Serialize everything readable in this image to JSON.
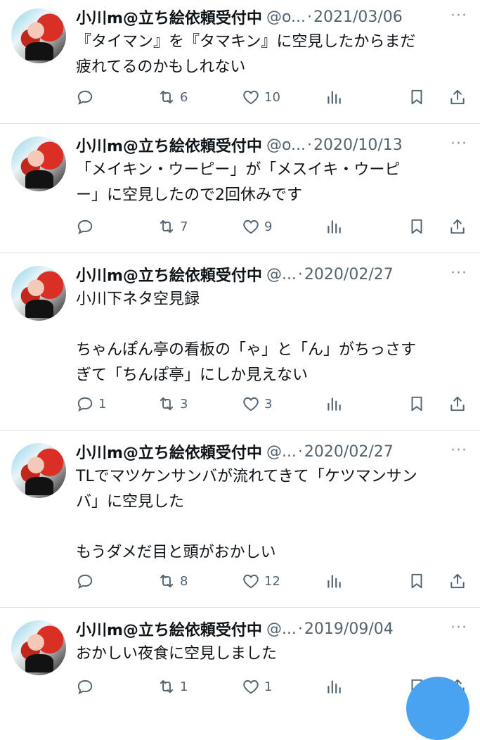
{
  "tweets": [
    {
      "name": "小川m@立ち絵依頼受付中",
      "handle": "@o...",
      "date": "2021/03/06",
      "text": "『タイマン』を『タマキン』に空見したからまだ\n疲れてるのかもしれない",
      "replies": "",
      "retweets": "6",
      "likes": "10"
    },
    {
      "name": "小川m@立ち絵依頼受付中",
      "handle": "@o...",
      "date": "2020/10/13",
      "text": "「メイキン・ウーピー」が「メスイキ・ウーピ\nー」に空見したので2回休みです",
      "replies": "",
      "retweets": "7",
      "likes": "9"
    },
    {
      "name": "小川m@立ち絵依頼受付中",
      "handle": "@...",
      "date": "2020/02/27",
      "text": "小川下ネタ空見録\n\nちゃんぽん亭の看板の「ゃ」と「ん」がちっさす\nぎて「ちんぽ亭」にしか見えない",
      "replies": "1",
      "retweets": "3",
      "likes": "3"
    },
    {
      "name": "小川m@立ち絵依頼受付中",
      "handle": "@...",
      "date": "2020/02/27",
      "text": "TLでマツケンサンバが流れてきて「ケツマンサン\nバ」に空見した\n\nもうダメだ目と頭がおかしい",
      "replies": "",
      "retweets": "8",
      "likes": "12"
    },
    {
      "name": "小川m@立ち絵依頼受付中",
      "handle": "@...",
      "date": "2019/09/04",
      "text": "おかしい夜食に空見しました",
      "replies": "",
      "retweets": "1",
      "likes": "1"
    }
  ],
  "more_label": "···",
  "separator": "·",
  "icons": {
    "reply": "reply-icon",
    "retweet": "retweet-icon",
    "like": "like-icon",
    "views": "views-icon",
    "bookmark": "bookmark-icon",
    "share": "share-icon"
  },
  "colors": {
    "text": "#0f1419",
    "muted": "#536471",
    "divider": "#dfe3e6",
    "fab": "#4aa3f0"
  }
}
